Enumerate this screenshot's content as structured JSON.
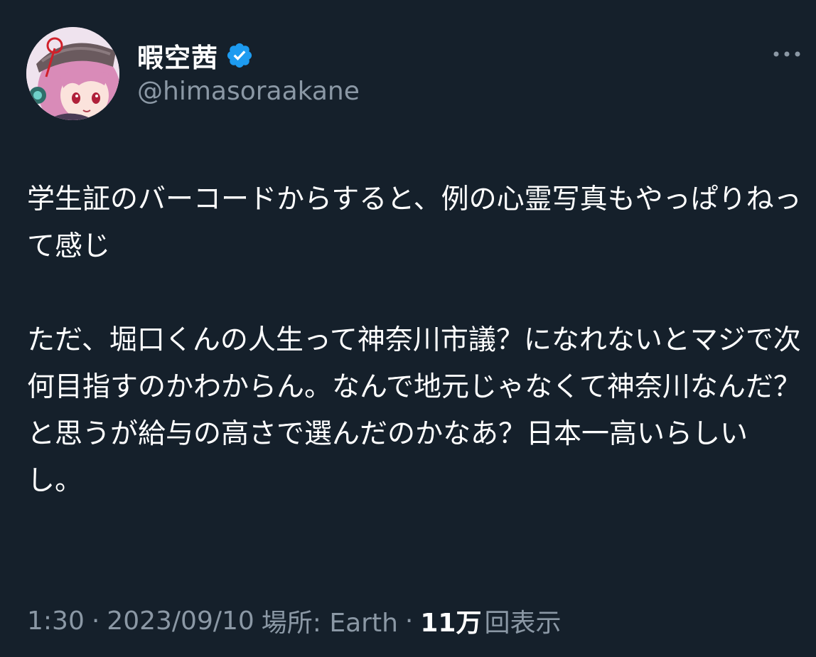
{
  "author": {
    "display_name": "暇空茜",
    "handle": "@himasoraakane",
    "verified": true,
    "verified_color": "#1d9bf0"
  },
  "tweet": {
    "text": "学生証のバーコードからすると、例の心霊写真もやっぱりねって感じ\n\nただ、堀口くんの人生って神奈川市議？になれないとマジで次何目指すのかわからん。なんで地元じゃなくて神奈川なんだ？と思うが給与の高さで選んだのかなあ？日本一高いらしいし。"
  },
  "meta": {
    "time": "1:30",
    "date": "2023/09/10",
    "location_label": "場所: Earth",
    "views_count": "11万",
    "views_label": "回表示",
    "separator": "·"
  },
  "icons": {
    "more": "more-options-icon",
    "verified": "verified-badge-icon"
  },
  "colors": {
    "background": "#15202b",
    "secondary_text": "#8b98a5",
    "primary_text": "#ffffff"
  }
}
